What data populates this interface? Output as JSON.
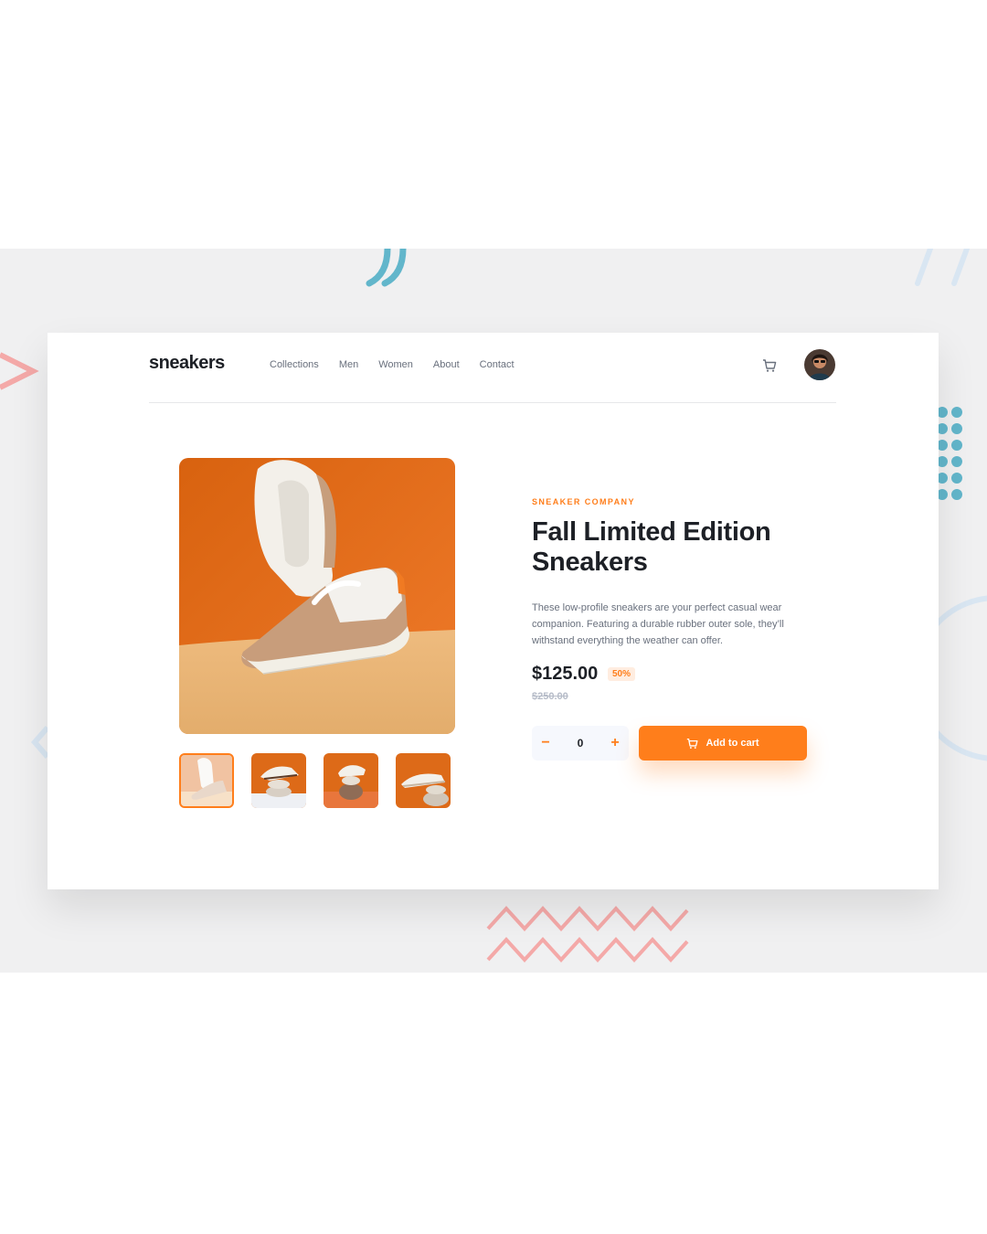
{
  "header": {
    "logo": "sneakers",
    "nav": [
      "Collections",
      "Men",
      "Women",
      "About",
      "Contact"
    ],
    "cart_icon": "cart-icon",
    "avatar_icon": "avatar"
  },
  "gallery": {
    "thumbnails": 4,
    "active_thumbnail": 1
  },
  "product": {
    "company": "SNEAKER COMPANY",
    "title": "Fall Limited Edition Sneakers",
    "description": "These low-profile sneakers are your perfect casual wear companion. Featuring a durable rubber outer sole, they’ll withstand everything the weather can offer.",
    "price": "$125.00",
    "discount": "50%",
    "original_price": "$250.00"
  },
  "cart_controls": {
    "minus": "−",
    "quantity": "0",
    "plus": "+",
    "add_label": "Add to cart"
  },
  "colors": {
    "accent": "#ff7e1b",
    "background_band": "#f0f0f1",
    "text_dark": "#1d2026",
    "text_muted": "#69707d"
  }
}
